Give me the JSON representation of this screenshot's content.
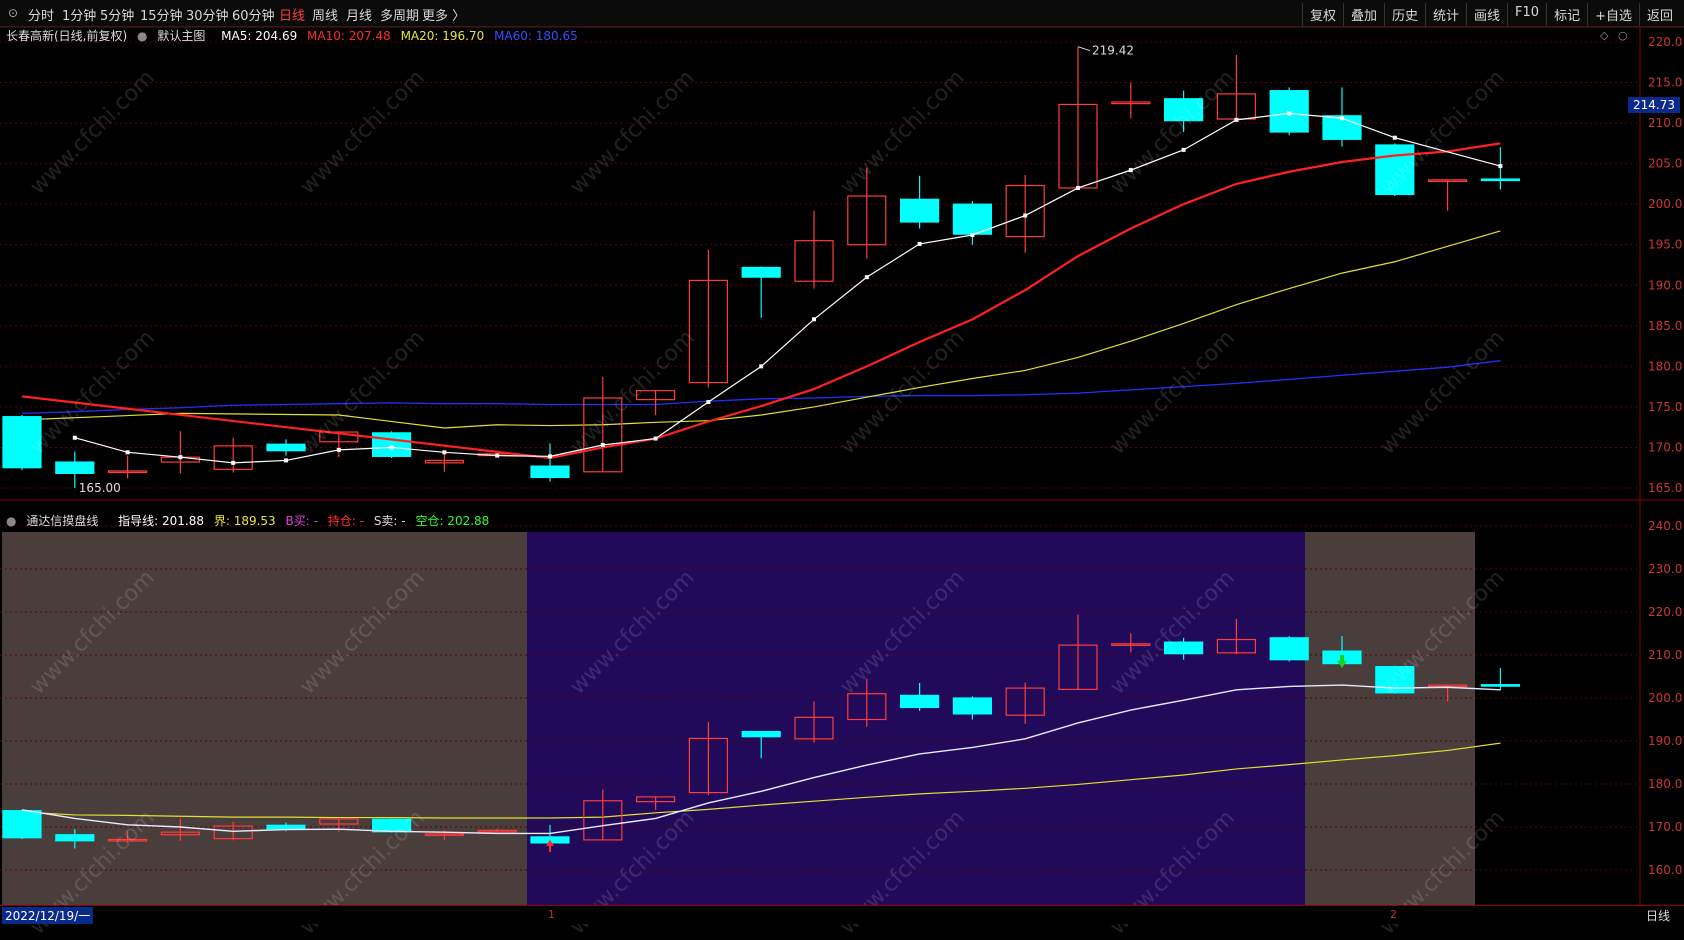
{
  "toolbar": {
    "periods": [
      "分时",
      "1分钟",
      "5分钟",
      "15分钟",
      "30分钟",
      "60分钟",
      "日线",
      "周线",
      "月线",
      "多周期",
      "更多 〉"
    ],
    "active_period": "日线",
    "right_buttons": [
      "复权",
      "叠加",
      "历史",
      "统计",
      "画线",
      "F10",
      "标记",
      "+自选",
      "返回"
    ]
  },
  "main_legend": {
    "stock": "长春高新(日线,前复权)",
    "template": "默认主图",
    "ma5": "MA5: 204.69",
    "ma10": "MA10: 207.48",
    "ma20": "MA20: 196.70",
    "ma60": "MA60: 180.65"
  },
  "sub_legend": {
    "name": "通达信摸盘线",
    "guide": "指导线: 201.88",
    "bound": "界: 189.53",
    "buy": "B买: -",
    "hold": "持仓: -",
    "sell": "S卖: -",
    "empty": "空仓: 202.88"
  },
  "colors": {
    "up": "#ff3b3b",
    "down": "#00ffff",
    "ma5": "#ffffff",
    "ma10": "#ff2020",
    "ma20": "#e0e030",
    "ma60": "#2030ff",
    "bg_hold": "#210a5a",
    "bg_empty": "#4a3e3d"
  },
  "main_axis": [
    "220.0",
    "215.0",
    "210.0",
    "205.0",
    "200.0",
    "195.0",
    "190.0",
    "185.0",
    "180.0",
    "175.0",
    "170.0",
    "165.0"
  ],
  "sub_axis": [
    "240.0",
    "230.0",
    "220.0",
    "210.0",
    "200.0",
    "190.0",
    "180.0",
    "170.0",
    "160.0"
  ],
  "last_price_tag": "214.73",
  "high_label": "219.42",
  "low_label": "165.00",
  "bottom": {
    "date": "2022/12/19/一",
    "tick1": "1",
    "tick2": "2",
    "period": "日线"
  },
  "watermark": "www.cfchi.com",
  "chart_data": {
    "type": "candlestick",
    "candles": [
      {
        "o": 173.8,
        "c": 167.5,
        "h": 174.0,
        "l": 167.2
      },
      {
        "o": 168.2,
        "c": 166.8,
        "h": 169.5,
        "l": 165.0
      },
      {
        "o": 167.0,
        "c": 167.1,
        "h": 169.0,
        "l": 166.2
      },
      {
        "o": 168.2,
        "c": 168.8,
        "h": 172.0,
        "l": 166.8
      },
      {
        "o": 167.3,
        "c": 170.2,
        "h": 171.2,
        "l": 166.9
      },
      {
        "o": 170.4,
        "c": 169.6,
        "h": 171.0,
        "l": 169.0
      },
      {
        "o": 170.7,
        "c": 171.9,
        "h": 172.0,
        "l": 168.8
      },
      {
        "o": 171.8,
        "c": 168.9,
        "h": 172.0,
        "l": 168.7
      },
      {
        "o": 168.1,
        "c": 168.4,
        "h": 169.2,
        "l": 167.0
      },
      {
        "o": 169.0,
        "c": 169.2,
        "h": 169.6,
        "l": 168.8
      },
      {
        "o": 167.7,
        "c": 166.3,
        "h": 170.5,
        "l": 165.8
      },
      {
        "o": 167.0,
        "c": 176.1,
        "h": 178.7,
        "l": 167.0
      },
      {
        "o": 175.9,
        "c": 177.0,
        "h": 177.0,
        "l": 174.0
      },
      {
        "o": 178.0,
        "c": 190.6,
        "h": 194.4,
        "l": 177.4
      },
      {
        "o": 192.2,
        "c": 191.0,
        "h": 192.3,
        "l": 186.0
      },
      {
        "o": 190.5,
        "c": 195.5,
        "h": 199.2,
        "l": 189.6
      },
      {
        "o": 195.0,
        "c": 201.0,
        "h": 204.5,
        "l": 193.3
      },
      {
        "o": 200.6,
        "c": 197.8,
        "h": 203.5,
        "l": 197.0
      },
      {
        "o": 200.0,
        "c": 196.3,
        "h": 200.4,
        "l": 195.0
      },
      {
        "o": 196.0,
        "c": 202.3,
        "h": 203.6,
        "l": 194.0
      },
      {
        "o": 202.0,
        "c": 212.3,
        "h": 219.4,
        "l": 202.0
      },
      {
        "o": 212.4,
        "c": 212.6,
        "h": 215.0,
        "l": 210.6
      },
      {
        "o": 213.0,
        "c": 210.3,
        "h": 214.0,
        "l": 208.9
      },
      {
        "o": 210.5,
        "c": 213.6,
        "h": 218.4,
        "l": 210.2
      },
      {
        "o": 214.0,
        "c": 208.9,
        "h": 214.4,
        "l": 208.5
      },
      {
        "o": 210.9,
        "c": 208.0,
        "h": 214.4,
        "l": 207.1
      },
      {
        "o": 207.3,
        "c": 201.2,
        "h": 207.5,
        "l": 201.0
      },
      {
        "o": 203.0,
        "c": 203.0,
        "h": 203.0,
        "l": 199.2
      },
      {
        "o": 203.1,
        "c": 203.0,
        "h": 207.0,
        "l": 201.8
      }
    ],
    "ma5": [
      null,
      171.2,
      169.4,
      168.8,
      168.1,
      168.4,
      169.7,
      170.0,
      169.4,
      169.0,
      168.9,
      170.3,
      171.1,
      175.6,
      180.0,
      185.8,
      191.0,
      195.1,
      196.2,
      198.6,
      202.0,
      204.2,
      206.7,
      210.4,
      211.2,
      210.6,
      208.2,
      null,
      204.7
    ],
    "ma10": [
      176.3,
      null,
      null,
      null,
      null,
      null,
      null,
      null,
      null,
      null,
      168.7,
      170.0,
      171.1,
      173.2,
      175.1,
      177.2,
      180.0,
      183.0,
      185.8,
      189.4,
      193.6,
      197.0,
      200.0,
      202.5,
      204.0,
      205.2,
      206.0,
      206.5,
      207.5
    ],
    "ma20": [
      173.4,
      null,
      null,
      174.2,
      null,
      null,
      174.0,
      null,
      172.4,
      172.8,
      172.7,
      172.8,
      173.1,
      173.3,
      174.0,
      175.0,
      176.2,
      177.4,
      178.5,
      179.5,
      181.1,
      183.1,
      185.3,
      187.6,
      189.6,
      191.5,
      192.9,
      194.8,
      196.7
    ],
    "ma60": [
      174.2,
      174.4,
      174.7,
      174.9,
      175.2,
      175.3,
      175.4,
      175.5,
      175.4,
      175.4,
      175.3,
      175.3,
      175.3,
      175.7,
      176.0,
      176.1,
      176.3,
      176.4,
      176.4,
      176.5,
      176.7,
      177.1,
      177.5,
      177.9,
      178.4,
      178.9,
      179.4,
      179.9,
      180.7
    ],
    "guide": [
      174.0,
      172.0,
      170.5,
      170.0,
      169.0,
      169.4,
      169.5,
      169.0,
      168.8,
      168.5,
      168.5,
      170.3,
      172.0,
      175.6,
      178.3,
      181.5,
      184.4,
      187.0,
      188.5,
      190.5,
      194.2,
      197.2,
      199.5,
      201.9,
      202.7,
      203.0,
      202.3,
      202.5,
      201.9
    ],
    "bound": [
      173.5,
      172.8,
      172.7,
      172.5,
      172.3,
      172.3,
      172.2,
      172.2,
      172.1,
      172.1,
      172.1,
      172.3,
      173.3,
      174.1,
      175.1,
      176.0,
      176.9,
      177.7,
      178.3,
      179.0,
      179.9,
      181.0,
      182.1,
      183.5,
      184.5,
      185.6,
      186.6,
      187.8,
      189.5
    ],
    "zones": [
      {
        "from": 0,
        "to": 9,
        "state": "empty"
      },
      {
        "from": 10,
        "to": 24,
        "state": "hold"
      },
      {
        "from": 25,
        "to": 27,
        "state": "empty"
      }
    ],
    "buy_signal_index": 10,
    "sell_signal_index": 25
  }
}
